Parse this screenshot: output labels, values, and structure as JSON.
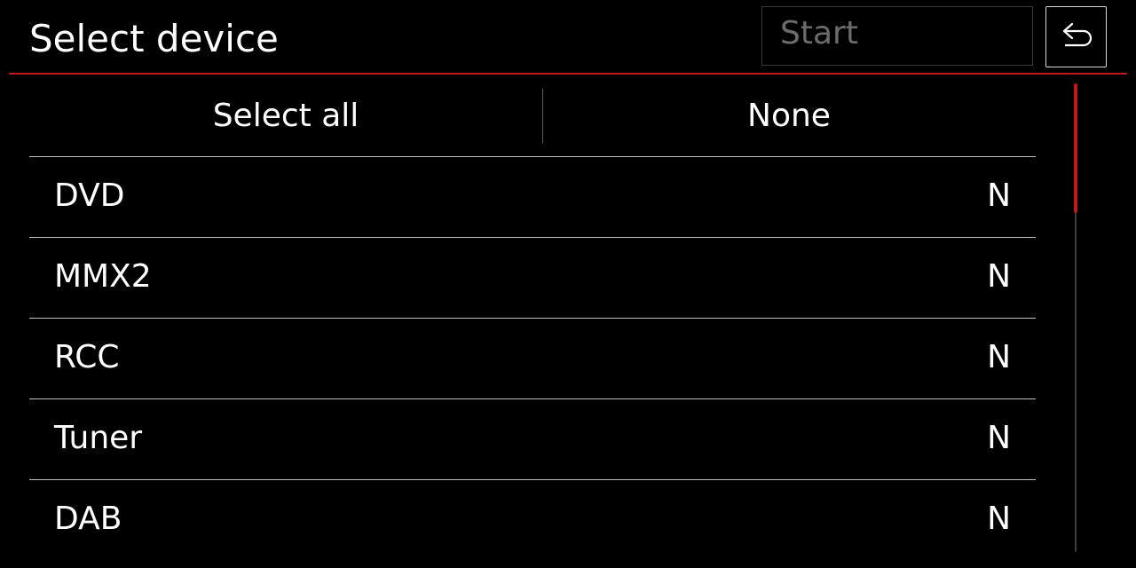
{
  "header": {
    "title": "Select device",
    "start_label": "Start",
    "back_icon": "return-arrow-icon"
  },
  "selection": {
    "select_all_label": "Select all",
    "none_label": "None"
  },
  "devices": [
    {
      "name": "DVD",
      "value": "N"
    },
    {
      "name": "MMX2",
      "value": "N"
    },
    {
      "name": "RCC",
      "value": "N"
    },
    {
      "name": "Tuner",
      "value": "N"
    },
    {
      "name": "DAB",
      "value": "N"
    }
  ],
  "colors": {
    "accent": "#c0161c",
    "background": "#000000",
    "text": "#ffffff",
    "disabled_text": "#6c6c6c"
  }
}
